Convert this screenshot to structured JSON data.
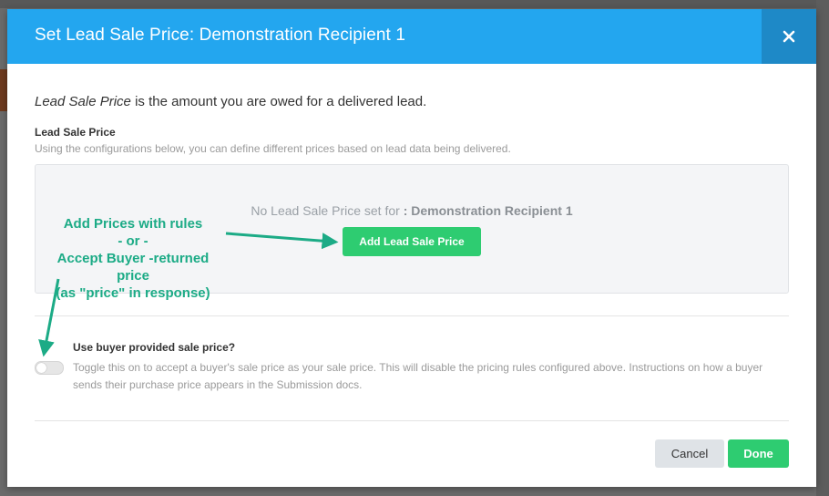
{
  "modal": {
    "title": "Set Lead Sale Price: Demonstration Recipient 1",
    "close_icon": "close-icon",
    "close_symbol": "✕",
    "intro_term": "Lead Sale Price",
    "intro_rest": " is the amount you are owed for a delivered lead.",
    "section_label": "Lead Sale Price",
    "section_desc": "Using the configurations below, you can define different prices based on lead data being delivered.",
    "empty_prefix": "No Lead Sale Price set for ",
    "empty_recipient": ": Demonstration Recipient 1",
    "add_button": "Add Lead Sale Price",
    "toggle_label": "Use buyer provided sale price?",
    "toggle_desc": "Toggle this on to accept a buyer's sale price as your sale price. This will disable the pricing rules configured above. Instructions on how a buyer sends their purchase price appears in the Submission docs.",
    "toggle_on": false,
    "cancel_button": "Cancel",
    "done_button": "Done"
  },
  "annotation": {
    "lines": [
      "Add Prices with rules",
      "- or -",
      "Accept Buyer -returned",
      "price",
      "(as \"price\" in response)"
    ],
    "color": "#1cab86"
  },
  "colors": {
    "header": "#23a6ef",
    "close_bg": "#1e89c7",
    "primary_button": "#2ecc71",
    "cancel_button": "#dfe3e7"
  }
}
